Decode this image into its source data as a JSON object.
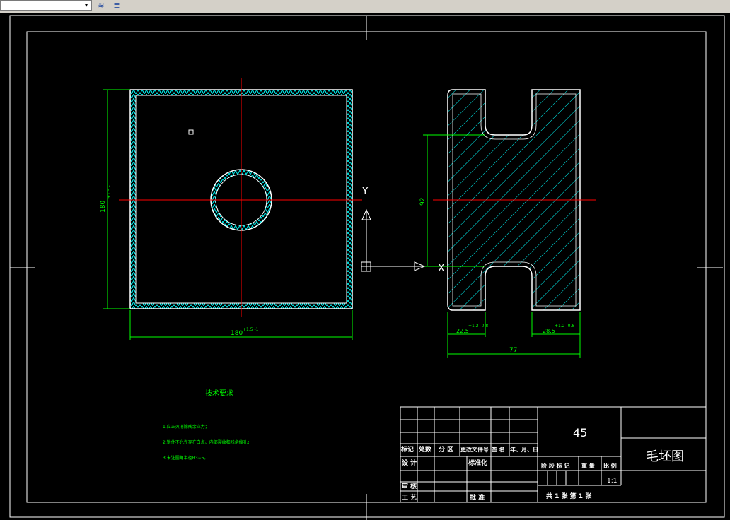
{
  "toolbar": {
    "layer_combo": "",
    "layer_combo_arrow": "▾",
    "btn1_icon": "layer-stack-icon",
    "btn2_icon": "layer-state-icon",
    "btn1_glyph": "≋",
    "btn2_glyph": "≣"
  },
  "colors": {
    "background": "#000000",
    "border": "#ffffff",
    "outline": "#ffffff",
    "dimension": "#00ff00",
    "centerline": "#ff0000",
    "hatch": "#00ffff",
    "notes": "#00ff00"
  },
  "drawing": {
    "left_view": {
      "height_dim": "180",
      "height_tol": "+1.5 -1",
      "width_dim": "180",
      "width_tol": "+1.5 -1"
    },
    "right_view": {
      "gap_dim": "92",
      "left_dim": "22.5",
      "left_tol": "+1.2 -0.8",
      "right_dim": "28.5",
      "right_tol": "+1.2 -0.8",
      "total_dim": "77"
    },
    "ucs": {
      "y_label": "Y",
      "x_label": "X"
    }
  },
  "notes": {
    "title": "技术要求",
    "items": [
      "1.应正火消除残余应力；",
      "2.锻件不允许存在白点、内部裂纹和残余缩孔；",
      "3.未注圆角半径R3~5。"
    ]
  },
  "title_block": {
    "material": "45",
    "drawing_name": "毛坯图",
    "headers": [
      "标记",
      "处数",
      "分 区",
      "更改文件号",
      "签 名",
      "年、月、日"
    ],
    "design": "设 计",
    "standardize": "标准化",
    "review": "审 核",
    "process": "工 艺",
    "approve": "批 准",
    "stage_label": "阶 段 标 记",
    "weight_label": "重 量",
    "scale_label": "比 例",
    "scale": "1:1",
    "sheets": "共 1   张   第   1 张"
  }
}
